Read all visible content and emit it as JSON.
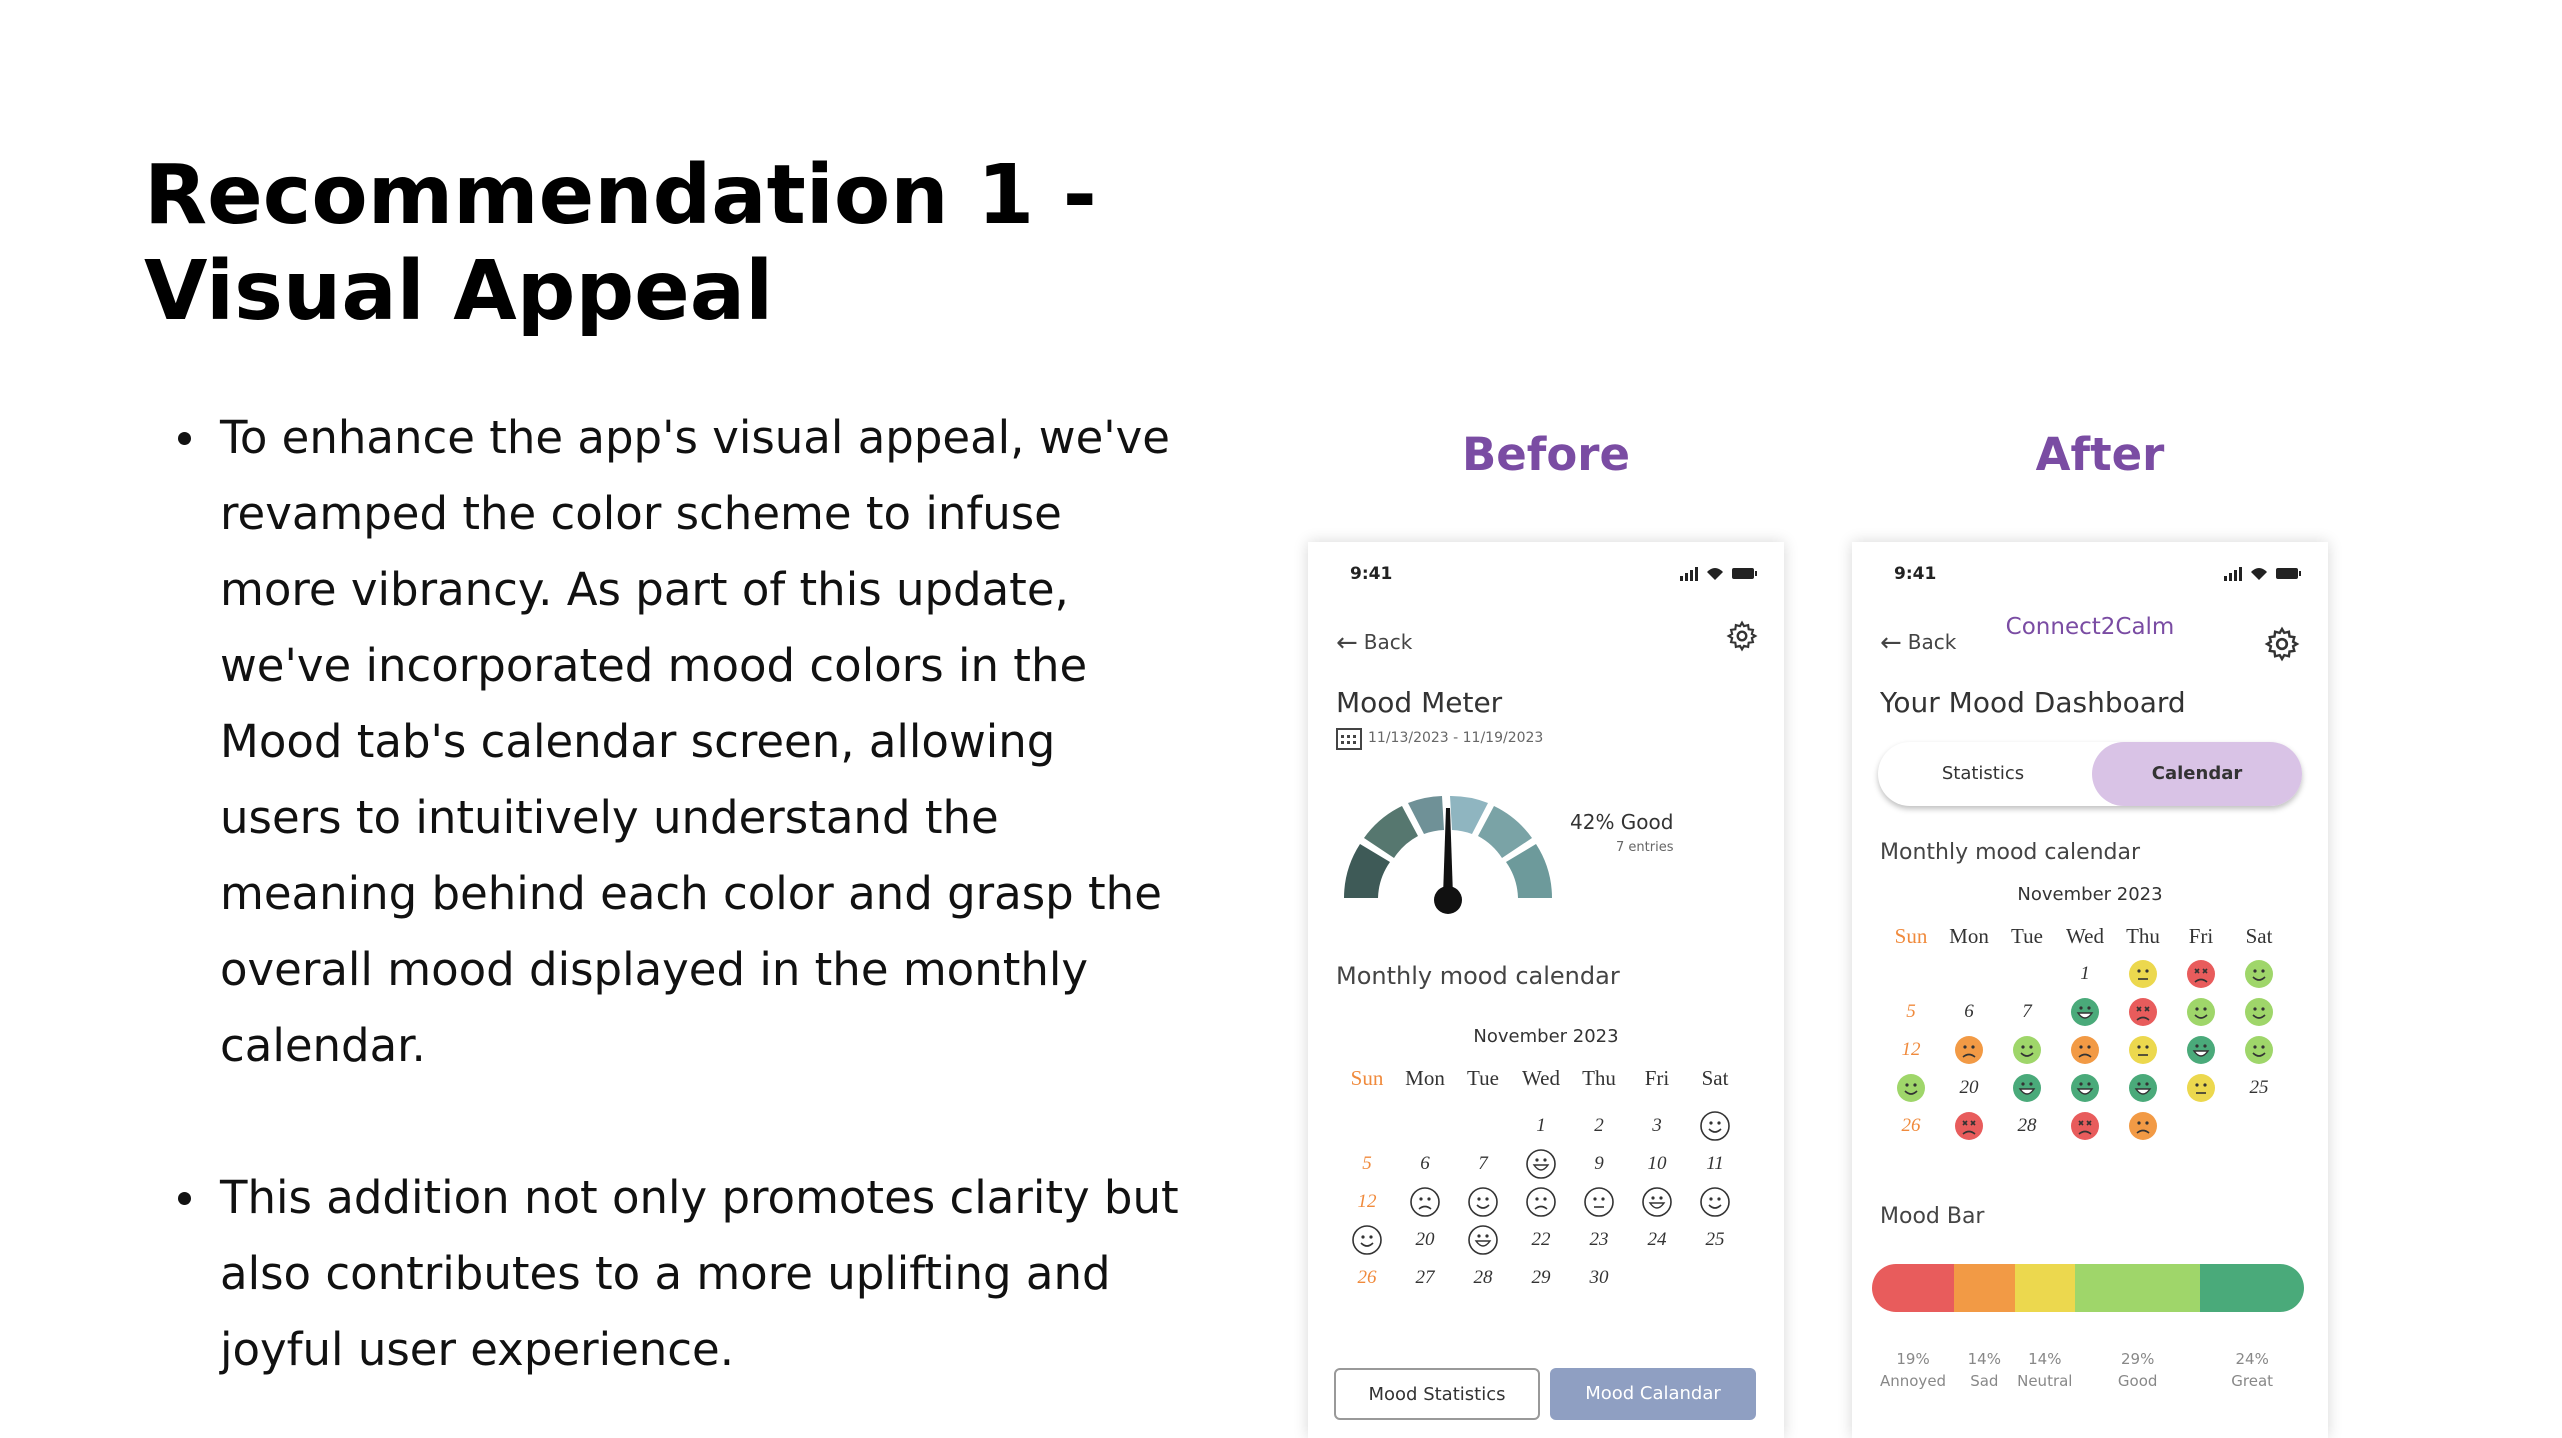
{
  "slide": {
    "title_line1": "Recommendation 1 -",
    "title_line2": "Visual Appeal",
    "bullets": [
      "To enhance the app's visual appeal, we've revamped the color scheme to infuse more vibrancy. As part of this update, we've incorporated mood colors in the Mood tab's calendar screen, allowing users to intuitively understand the meaning behind each color and grasp the overall mood displayed in the monthly calendar.",
      "This addition not only promotes clarity but also contributes to a more uplifting and joyful user experience."
    ],
    "before_label": "Before",
    "after_label": "After"
  },
  "before": {
    "time": "9:41",
    "back": "Back",
    "title": "Mood Meter",
    "date_range": "11/13/2023 - 11/19/2023",
    "gauge_pct": "42% Good",
    "gauge_entries": "7 entries",
    "section": "Monthly mood calendar",
    "month": "November 2023",
    "weekdays": [
      "Sun",
      "Mon",
      "Tue",
      "Wed",
      "Thu",
      "Fri",
      "Sat"
    ],
    "btn_stats": "Mood Statistics",
    "btn_cal": "Mood Calandar"
  },
  "after": {
    "time": "9:41",
    "back": "Back",
    "app_name": "Connect2Calm",
    "title": "Your Mood Dashboard",
    "tab_stats": "Statistics",
    "tab_cal": "Calendar",
    "section": "Monthly mood calendar",
    "month": "November 2023",
    "weekdays": [
      "Sun",
      "Mon",
      "Tue",
      "Wed",
      "Thu",
      "Fri",
      "Sat"
    ],
    "mood_bar_title": "Mood Bar",
    "mood_bar": [
      {
        "pct": "19%",
        "label": "Annoyed",
        "color": "#e85c5c",
        "share": 0.19
      },
      {
        "pct": "14%",
        "label": "Sad",
        "color": "#f29a45",
        "share": 0.14
      },
      {
        "pct": "14%",
        "label": "Neutral",
        "color": "#ecd84e",
        "share": 0.14
      },
      {
        "pct": "29%",
        "label": "Good",
        "color": "#9fd66a",
        "share": 0.29
      },
      {
        "pct": "24%",
        "label": "Great",
        "color": "#4aaa7a",
        "share": 0.24
      }
    ]
  },
  "colors": {
    "accent_purple": "#7a4ca3",
    "sunday_orange": "#f08a3c",
    "tab_active": "#d9c3e6",
    "before_btn_active": "#8f9fc2"
  }
}
